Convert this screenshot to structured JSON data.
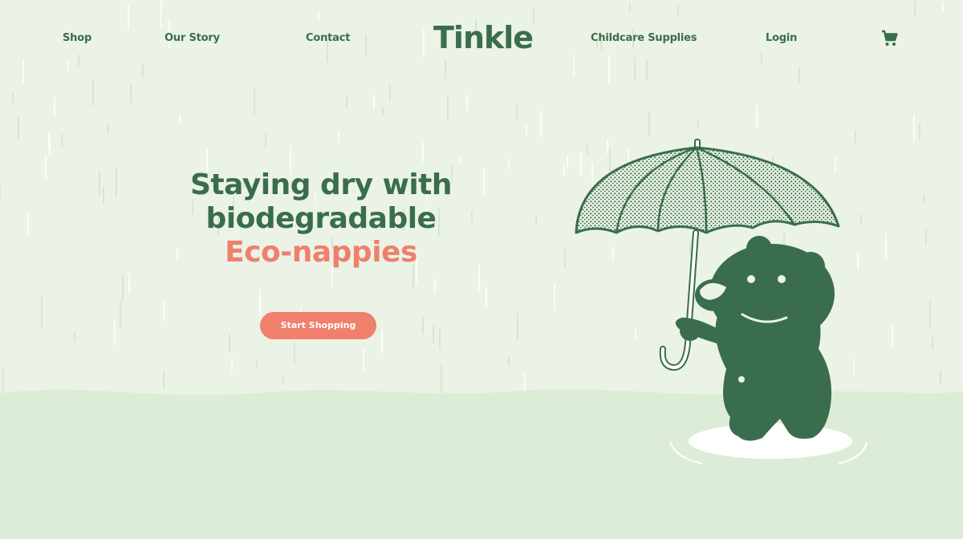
{
  "nav": {
    "shop": "Shop",
    "our_story": "Our Story",
    "contact": "Contact",
    "logo": "Tinkle",
    "childcare_supplies": "Childcare Supplies",
    "login": "Login",
    "cart_icon": "shopping-cart-icon"
  },
  "hero": {
    "line1": "Staying dry with",
    "line2": "biodegradable",
    "line3": "Eco-nappies",
    "cta_label": "Start Shopping"
  },
  "colors": {
    "background": "#eaf3e5",
    "ground": "#dcecd6",
    "primary_green": "#3a6d4d",
    "accent_coral": "#f07f6c",
    "white": "#ffffff"
  },
  "illustration": {
    "subject": "bear-with-umbrella",
    "icons": [
      "umbrella-icon",
      "bear-icon",
      "puddle-icon"
    ]
  }
}
